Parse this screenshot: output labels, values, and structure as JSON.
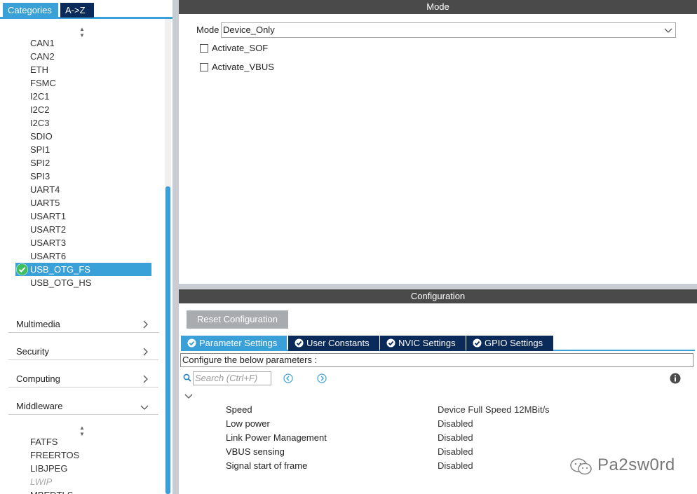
{
  "left_tabs": {
    "categories": "Categories",
    "az": "A->Z"
  },
  "peripherals": [
    "CAN1",
    "CAN2",
    "ETH",
    "FSMC",
    "I2C1",
    "I2C2",
    "I2C3",
    "SDIO",
    "SPI1",
    "SPI2",
    "SPI3",
    "UART4",
    "UART5",
    "USART1",
    "USART2",
    "USART3",
    "USART6",
    "USB_OTG_FS",
    "USB_OTG_HS"
  ],
  "selected_peripheral": "USB_OTG_FS",
  "categories": {
    "multimedia": "Multimedia",
    "security": "Security",
    "computing": "Computing",
    "middleware": "Middleware"
  },
  "middleware_items": [
    "FATFS",
    "FREERTOS",
    "LIBJPEG",
    "LWIP",
    "MBEDTLS"
  ],
  "mode_panel": {
    "header": "Mode",
    "mode_label": "Mode",
    "mode_value": "Device_Only",
    "checkboxes": [
      "Activate_SOF",
      "Activate_VBUS"
    ]
  },
  "config_panel": {
    "header": "Configuration",
    "reset_button": "Reset Configuration",
    "tabs": [
      "Parameter Settings",
      "User Constants",
      "NVIC Settings",
      "GPIO Settings"
    ],
    "hint": "Configure the below parameters :",
    "search_placeholder": "Search (Ctrl+F)",
    "params": [
      {
        "name": "Speed",
        "value": "Device Full Speed 12MBit/s"
      },
      {
        "name": "Low power",
        "value": "Disabled"
      },
      {
        "name": "Link Power Management",
        "value": "Disabled"
      },
      {
        "name": "VBUS sensing",
        "value": "Disabled"
      },
      {
        "name": "Signal start of frame",
        "value": "Disabled"
      }
    ]
  },
  "watermark": "Pa2sw0rd",
  "colors": {
    "accent": "#3aa0d8",
    "tab_dark": "#0a2a5a",
    "header": "#4a4a4a",
    "check": "#3fbf5f"
  }
}
